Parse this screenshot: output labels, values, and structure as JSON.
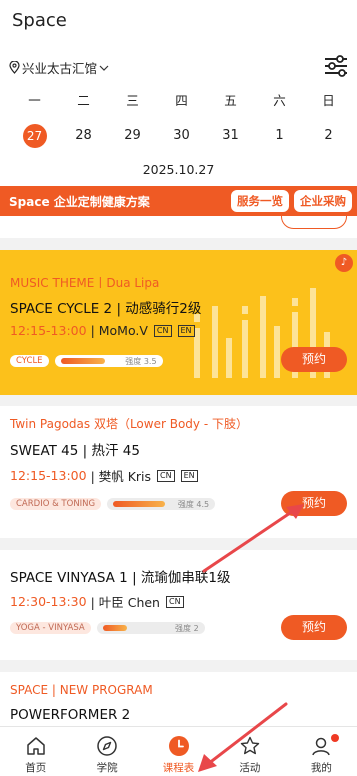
{
  "app": {
    "title": "Space"
  },
  "location": {
    "name": "兴业太古汇馆"
  },
  "calendar": {
    "weekdays": [
      "一",
      "二",
      "三",
      "四",
      "五",
      "六",
      "日"
    ],
    "dates": [
      "27",
      "28",
      "29",
      "30",
      "31",
      "1",
      "2"
    ],
    "selected_index": 0,
    "current_date": "2025.10.27"
  },
  "promo": {
    "text": "Space 企业定制健康方案",
    "services_label": "服务一览",
    "procurement_label": "企业采购"
  },
  "classes": [
    {
      "theme": "MUSIC THEME丨Dua Lipa",
      "name": "SPACE CYCLE 2 | 动感骑行2级",
      "time": "12:15-13:00",
      "coach": "| MoMo.V",
      "langs": [
        "CN",
        "EN"
      ],
      "tag": "CYCLE",
      "intensity_label": "强度 3.5",
      "intensity": 0.7,
      "book_label": "预约"
    },
    {
      "theme": "Twin Pagodas 双塔（Lower Body - 下肢）",
      "name": "SWEAT 45 | 热汗 45",
      "time": "12:15-13:00",
      "coach": "| 樊帆 Kris",
      "langs": [
        "CN",
        "EN"
      ],
      "tag": "CARDIO & TONING",
      "intensity_label": "强度 4.5",
      "intensity": 0.9,
      "book_label": "预约"
    },
    {
      "theme": "",
      "name": "SPACE VINYASA 1 | 流瑜伽串联1级",
      "time": "12:30-13:30",
      "coach": "| 叶臣 Chen",
      "langs": [
        "CN"
      ],
      "tag": "YOGA - VINYASA",
      "intensity_label": "强度 2",
      "intensity": 0.4,
      "book_label": "预约"
    },
    {
      "theme": "SPACE | NEW PROGRAM",
      "name": "POWERFORMER 2"
    }
  ],
  "tabbar": {
    "tabs": [
      {
        "label": "首页",
        "icon": "home-icon"
      },
      {
        "label": "学院",
        "icon": "compass-icon"
      },
      {
        "label": "课程表",
        "icon": "clock-icon"
      },
      {
        "label": "活动",
        "icon": "star-icon"
      },
      {
        "label": "我的",
        "icon": "profile-icon"
      }
    ],
    "active_index": 2
  },
  "colors": {
    "accent": "#ef5a24",
    "featured_card": "#fcc11b",
    "annotation_arrow": "#e8474a"
  }
}
